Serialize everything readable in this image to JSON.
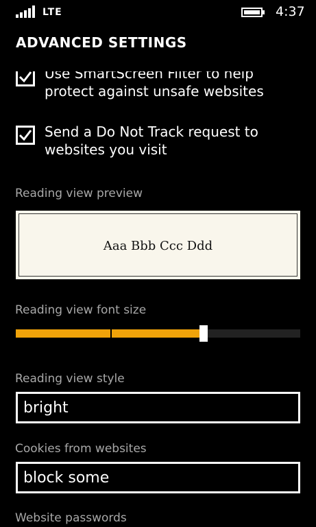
{
  "status_bar": {
    "network": "LTE",
    "time": "4:37"
  },
  "header": {
    "title": "ADVANCED SETTINGS"
  },
  "settings": {
    "smartscreen": {
      "label": "Use SmartScreen Filter to help protect against unsafe websites",
      "checked": true
    },
    "do_not_track": {
      "label": "Send a Do Not Track request to websites you visit",
      "checked": true
    },
    "reading_preview": {
      "label": "Reading view preview",
      "sample_text": "Aaa Bbb Ccc Ddd"
    },
    "font_size": {
      "label": "Reading view font size",
      "level": 0.66
    },
    "reading_style": {
      "label": "Reading view style",
      "value": "bright"
    },
    "cookies": {
      "label": "Cookies from websites",
      "value": "block some"
    },
    "passwords": {
      "label": "Website passwords"
    }
  },
  "colors": {
    "accent": "#f0a30a",
    "background": "#000000",
    "secondary_text": "#a8a8a8",
    "preview_background": "#f9f6ec"
  }
}
